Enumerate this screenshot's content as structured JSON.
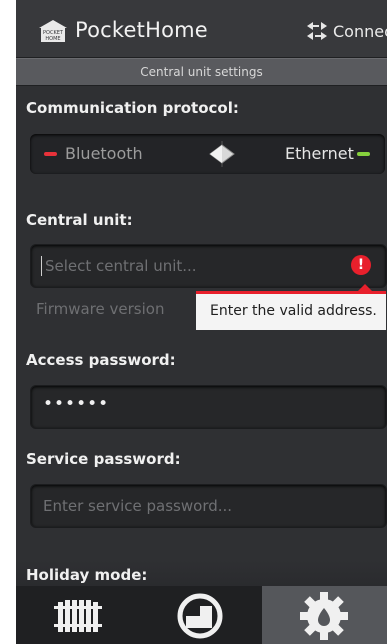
{
  "app": {
    "title": "PocketHome",
    "logo_text_top": "POCKET",
    "logo_text_bottom": "HOME",
    "connect_label": "Connect"
  },
  "subheader": {
    "title": "Central unit settings"
  },
  "protocol": {
    "label": "Communication protocol:",
    "option_left": "Bluetooth",
    "option_right": "Ethernet",
    "selected": "Ethernet",
    "colors": {
      "off": "#e8323a",
      "on": "#86d13d"
    }
  },
  "central_unit": {
    "label": "Central unit:",
    "placeholder": "Select central unit...",
    "value": "",
    "error_icon": "!",
    "error_color": "#e8202c",
    "firmware_label": "Firmware version",
    "tooltip": "Enter the valid address."
  },
  "access_password": {
    "label": "Access password:",
    "value": "••••••"
  },
  "service_password": {
    "label": "Service password:",
    "placeholder": "Enter service password..."
  },
  "holiday": {
    "label": "Holiday mode:"
  },
  "nav": {
    "tabs": [
      {
        "icon": "radiator-icon",
        "active": false
      },
      {
        "icon": "gauge-icon",
        "active": false
      },
      {
        "icon": "gear-icon",
        "active": true
      }
    ]
  }
}
